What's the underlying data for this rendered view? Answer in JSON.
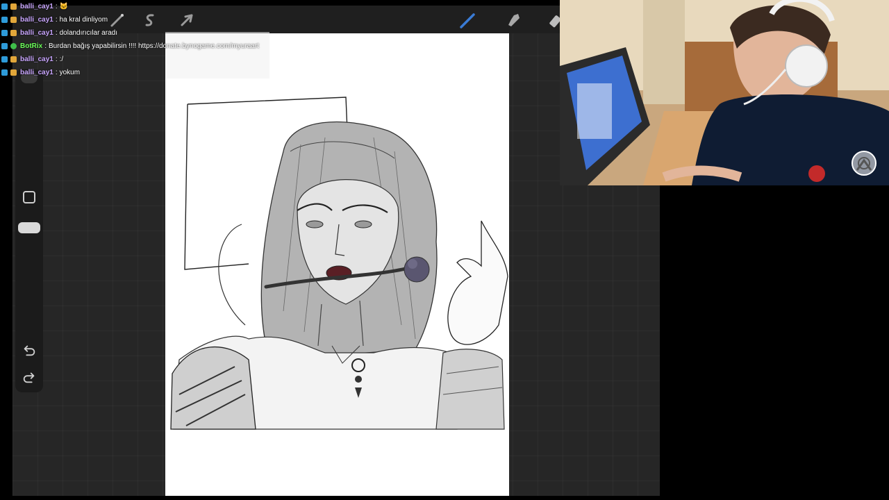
{
  "app": {
    "canvas_background": "#ffffff",
    "accent_color": "#3a7bd5"
  },
  "toolbar": {
    "icons": [
      "magic-wand-icon",
      "selection-icon",
      "transform-arrow-icon",
      "brush-icon",
      "smudge-icon",
      "eraser-icon"
    ]
  },
  "sidebar": {
    "buttons": [
      "modify-square-button",
      "opacity-slider-handle",
      "undo-icon",
      "redo-icon"
    ]
  },
  "chat": {
    "colors": {
      "user": "#c9a6ff",
      "bot": "#6cff5a",
      "text": "#ffffff"
    },
    "messages": [
      {
        "user": "balli_cay1",
        "sep": ":",
        "text": "🐱",
        "is_bot": false
      },
      {
        "user": "balli_cay1",
        "sep": ":",
        "text": "ha kral dinliyom",
        "is_bot": false
      },
      {
        "user": "balli_cay1",
        "sep": ":",
        "text": "dolandırıcılar aradı",
        "is_bot": false
      },
      {
        "user": "BotRix",
        "sep": ":",
        "text": "Burdan bağış yapabilirsin !!!! https://donate.bynogame.com/myuraart",
        "is_bot": true
      },
      {
        "user": "balli_cay1",
        "sep": ":",
        "text": ":/",
        "is_bot": false
      },
      {
        "user": "balli_cay1",
        "sep": ":",
        "text": "yokum",
        "is_bot": false
      }
    ]
  },
  "webcam": {
    "overlay_icon": "stream-logo-icon"
  }
}
